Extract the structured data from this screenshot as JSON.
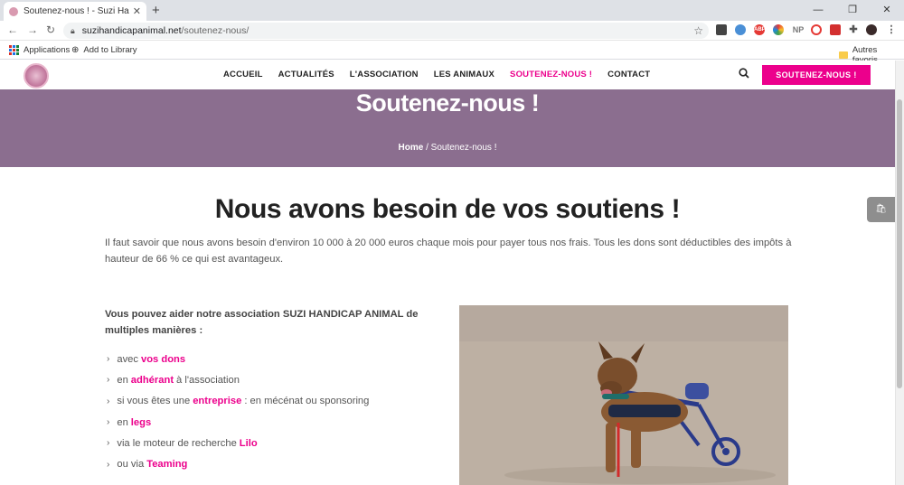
{
  "browser": {
    "tab_title": "Soutenez-nous ! - Suzi Handicap",
    "url_host": "suzihandicapanimal.net",
    "url_path": "/soutenez-nous/",
    "bookmarks": {
      "apps": "Applications",
      "add_to_library": "Add to Library",
      "other": "Autres favoris"
    },
    "extensions": [
      "tag-icon",
      "shield-icon",
      "adblock-icon",
      "color-icon",
      "np-icon",
      "target-icon",
      "adblock2-icon",
      "puzzle-icon",
      "avatar"
    ]
  },
  "header": {
    "menu": [
      {
        "label": "ACCUEIL"
      },
      {
        "label": "ACTUALITÉS"
      },
      {
        "label": "L'ASSOCIATION"
      },
      {
        "label": "LES ANIMAUX"
      },
      {
        "label": "SOUTENEZ-NOUS !",
        "active": true
      },
      {
        "label": "CONTACT"
      }
    ],
    "cta_label": "SOUTENEZ-NOUS !"
  },
  "hero": {
    "title": "Soutenez-nous !",
    "breadcrumb_home": "Home",
    "breadcrumb_sep": "/",
    "breadcrumb_current": "Soutenez-nous !"
  },
  "content": {
    "heading": "Nous avons besoin de vos soutiens !",
    "intro": "Il faut savoir que nous avons besoin d'environ 10 000 à 20 000 euros chaque mois pour payer tous nos frais. Tous les dons sont déductibles des impôts à hauteur de 66 % ce qui est avantageux.",
    "lead": "Vous pouvez aider notre association SUZI HANDICAP ANIMAL de multiples manières :",
    "list": [
      {
        "before": "avec",
        "highlight": "vos dons",
        "after": ""
      },
      {
        "before": "en",
        "highlight": "adhérant",
        "after": "à l'association"
      },
      {
        "before": "si vous êtes une",
        "highlight": "entreprise",
        "after": ": en mécénat ou sponsoring"
      },
      {
        "before": "en",
        "highlight": "legs",
        "after": ""
      },
      {
        "before": "via le moteur de recherche",
        "highlight": "Lilo",
        "after": ""
      },
      {
        "before": "ou via",
        "highlight": "Teaming",
        "after": ""
      }
    ]
  },
  "colors": {
    "accent": "#ec008c",
    "hero_bg": "#8b6e8f"
  }
}
